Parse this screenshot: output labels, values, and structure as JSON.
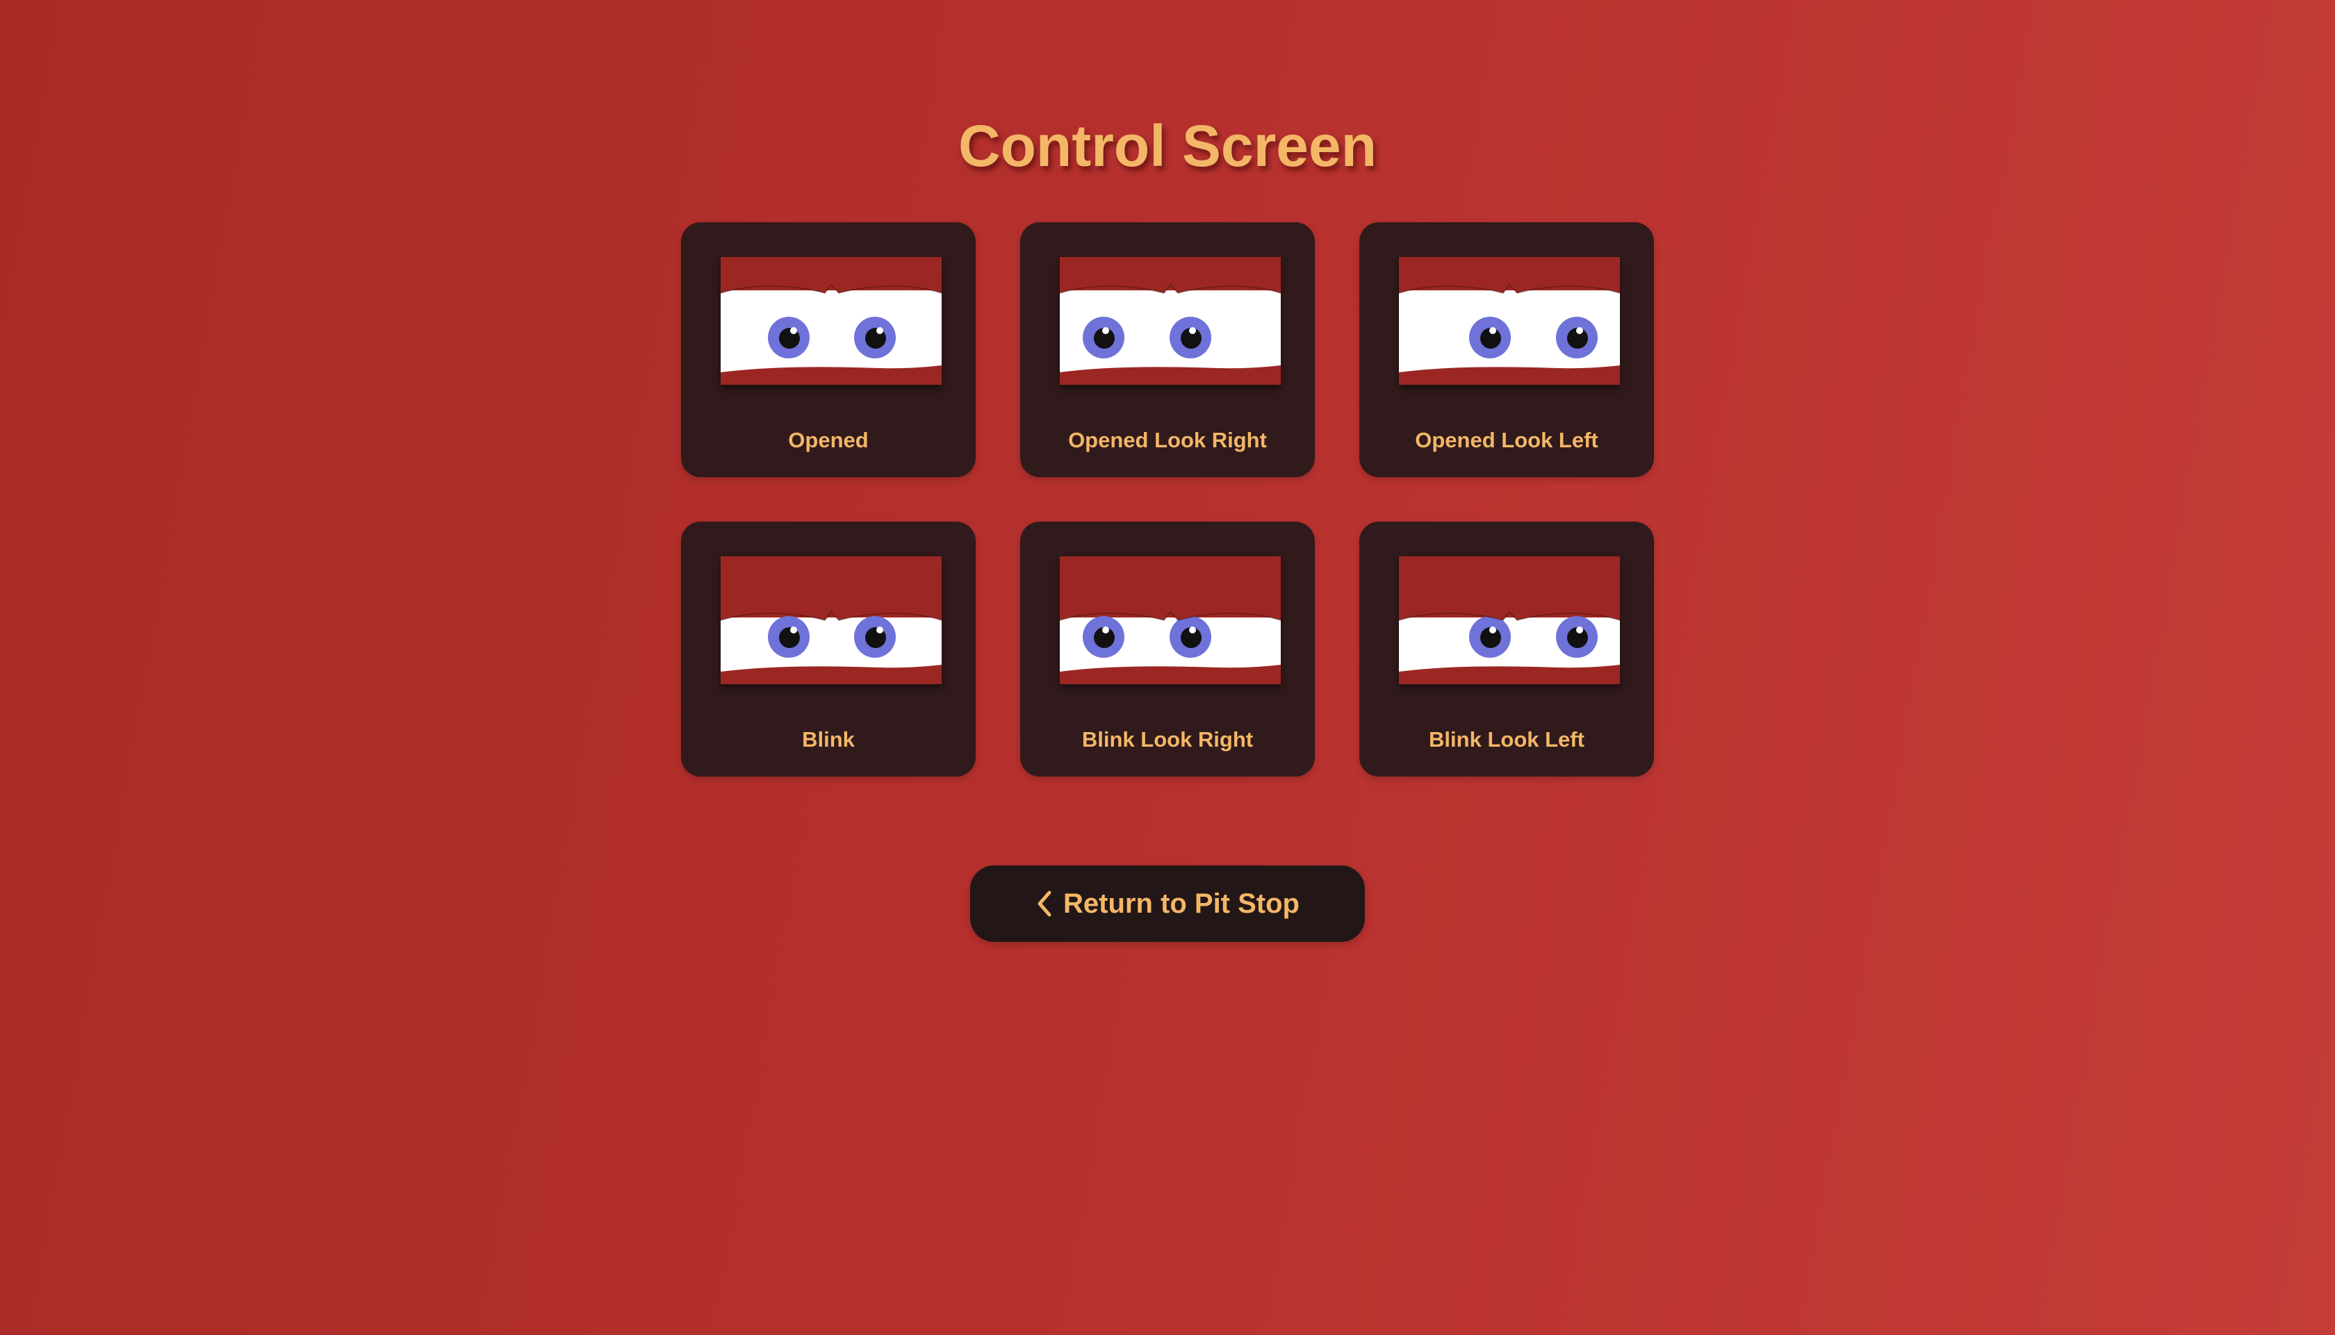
{
  "page": {
    "title": "Control Screen"
  },
  "colors": {
    "background": "#b8322f",
    "card": "#311a1b",
    "accent_text": "#f3b767",
    "eyelid": "#9c2722",
    "sclera": "#ffffff",
    "iris": "#6f72d8",
    "pupil": "#111111"
  },
  "cards": [
    {
      "label": "Opened",
      "state": "opened",
      "look": "center"
    },
    {
      "label": "Opened Look Right",
      "state": "opened",
      "look": "right"
    },
    {
      "label": "Opened Look Left",
      "state": "opened",
      "look": "left"
    },
    {
      "label": "Blink",
      "state": "blink",
      "look": "center"
    },
    {
      "label": "Blink Look Right",
      "state": "blink",
      "look": "right"
    },
    {
      "label": "Blink Look Left",
      "state": "blink",
      "look": "left"
    }
  ],
  "back_button": {
    "icon": "chevron-left-icon",
    "label": "Return to Pit Stop"
  }
}
